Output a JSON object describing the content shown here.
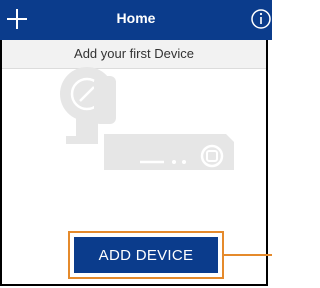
{
  "header": {
    "title": "Home",
    "add_icon": "plus-icon",
    "info_icon": "info-icon"
  },
  "subtitle": "Add your first Device",
  "illustration": "camera-and-recorder-illustration",
  "add_device_button": {
    "label": "ADD DEVICE"
  },
  "colors": {
    "header_bg": "#0b3c8c",
    "button_bg": "#0b3c8c",
    "highlight": "#e58a2b",
    "subtitle_bg": "#f2f2f2"
  }
}
